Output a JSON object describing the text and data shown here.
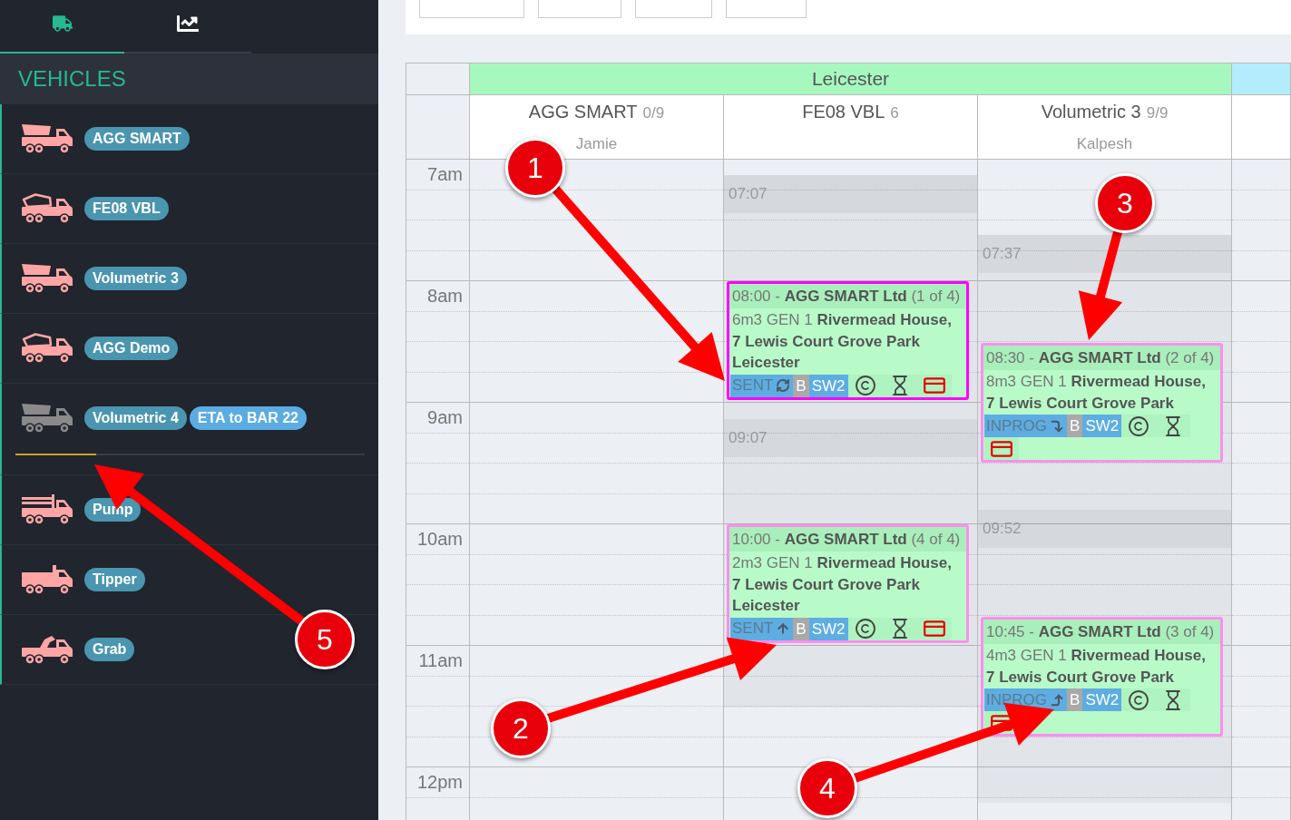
{
  "sidebar": {
    "tabs": [
      {
        "kind": "truck",
        "selected": true
      },
      {
        "kind": "chart",
        "selected": false
      }
    ],
    "section_title": "VEHICLES",
    "vehicles": [
      {
        "name": "AGG SMART",
        "kind": "dumper",
        "greyed": false
      },
      {
        "name": "FE08 VBL",
        "kind": "mixer",
        "greyed": false
      },
      {
        "name": "Volumetric 3",
        "kind": "dumper",
        "greyed": false
      },
      {
        "name": "AGG Demo",
        "kind": "mixer",
        "greyed": false
      },
      {
        "name": "Volumetric 4",
        "kind": "dumper",
        "greyed": true,
        "eta": "ETA to BAR 22",
        "progress": {
          "level": 0.23
        }
      },
      {
        "name": "Pump",
        "kind": "pump",
        "greyed": false
      },
      {
        "name": "Tipper",
        "kind": "flatbed",
        "greyed": false
      },
      {
        "name": "Grab",
        "kind": "grab",
        "greyed": false
      }
    ]
  },
  "calendar": {
    "groups": [
      {
        "name": "Leicester",
        "color": "#a6f8bf",
        "columns": [
          {
            "vehicle": "AGG SMART",
            "count": "0/9",
            "driver": "Jamie"
          },
          {
            "vehicle": "FE08 VBL",
            "count": "6",
            "trips": [
              {
                "start": "07:07"
              },
              {
                "start": "09:07"
              }
            ],
            "jobs": [
              {
                "title": "08:00 - **AGG SMART Ltd** (1 of 4)",
                "details": "6m3 GEN 1 **Rivermead House, 7 Lewis Court Grove Park Leicester**",
                "status": {
                  "text": "SENT",
                  "kind": "sync"
                },
                "tags": [
                  {
                    "text": "B",
                    "color": "#a9a9a9"
                  },
                  {
                    "text": "SW2",
                    "color": "#5dade2"
                  }
                ],
                "selected": true
              },
              {
                "title": "10:00 - **AGG SMART Ltd** (4 of 4)",
                "details": "2m3 GEN 1 **Rivermead House, 7 Lewis Court Grove Park Leicester**",
                "status": {
                  "text": "SENT",
                  "kind": "up"
                },
                "tags": [
                  {
                    "text": "B",
                    "color": "#a9a9a9"
                  },
                  {
                    "text": "SW2",
                    "color": "#5dade2"
                  }
                ],
                "selected": false
              }
            ]
          },
          {
            "vehicle": "Volumetric 3",
            "count": "9/9",
            "driver": "Kalpesh",
            "trips": [
              {
                "start": "07:37"
              },
              {
                "start": "09:52"
              }
            ],
            "jobs": [
              {
                "title": "08:30 - **AGG SMART Ltd** (2 of 4)",
                "details": "8m3 GEN 1 **Rivermead House, 7 Lewis Court Grove Park**",
                "status": {
                  "text": "INPROG",
                  "kind": "turn-down"
                },
                "tags": [
                  {
                    "text": "B",
                    "color": "#a9a9a9"
                  },
                  {
                    "text": "SW2",
                    "color": "#5dade2"
                  }
                ],
                "selected": false
              },
              {
                "title": "10:45 - **AGG SMART Ltd** (3 of 4)",
                "details": "4m3 GEN 1 **Rivermead House, 7 Lewis Court Grove Park**",
                "status": {
                  "text": "INPROG",
                  "kind": "turn-up"
                },
                "tags": [
                  {
                    "text": "B",
                    "color": "#a9a9a9"
                  },
                  {
                    "text": "SW2",
                    "color": "#5dade2"
                  }
                ],
                "selected": false
              }
            ]
          }
        ]
      },
      {
        "color": "#b3ecfb"
      }
    ],
    "hours": [
      "7am",
      "8am",
      "9am",
      "10am",
      "11am",
      "12pm"
    ]
  },
  "callouts": [
    {
      "number": "1"
    },
    {
      "number": "2"
    },
    {
      "number": "3"
    },
    {
      "number": "4"
    },
    {
      "number": "5"
    }
  ]
}
